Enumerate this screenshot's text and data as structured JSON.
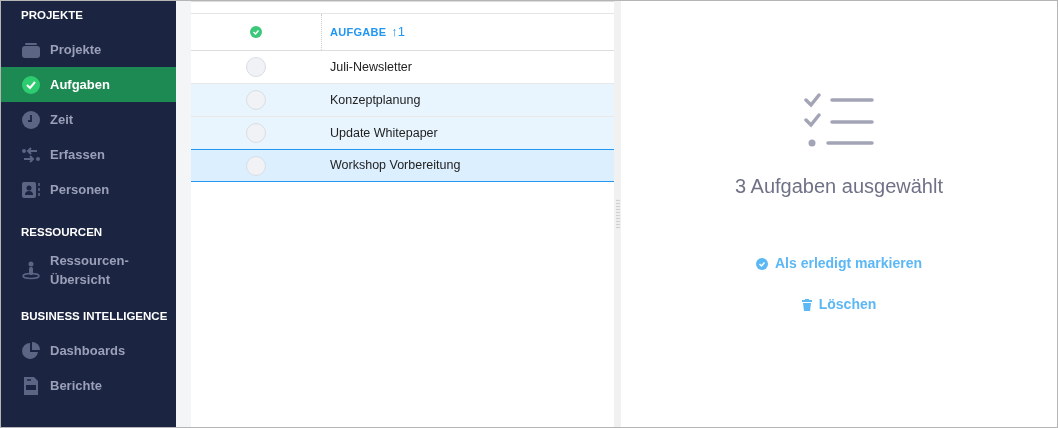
{
  "sidebar": {
    "sections": [
      {
        "title": "PROJEKTE",
        "items": [
          {
            "label": "Projekte",
            "kind": "stack",
            "selected": false
          },
          {
            "label": "Aufgaben",
            "kind": "check",
            "selected": true
          },
          {
            "label": "Zeit",
            "kind": "clock",
            "selected": false
          },
          {
            "label": "Erfassen",
            "kind": "swap",
            "selected": false
          },
          {
            "label": "Personen",
            "kind": "person",
            "selected": false
          }
        ]
      },
      {
        "title": "RESSOURCEN",
        "items": [
          {
            "label": "Ressourcen-Übersicht",
            "kind": "pin",
            "selected": false
          }
        ]
      },
      {
        "title": "BUSINESS INTELLIGENCE",
        "items": [
          {
            "label": "Dashboards",
            "kind": "pie",
            "selected": false
          },
          {
            "label": "Berichte",
            "kind": "doc",
            "selected": false
          }
        ]
      }
    ]
  },
  "table": {
    "column": "AUFGABE",
    "sort": "↑1",
    "rows": [
      {
        "task": "Juli-Newsletter",
        "selected": false,
        "focused": false
      },
      {
        "task": "Konzeptplanung",
        "selected": true,
        "focused": false
      },
      {
        "task": "Update Whitepaper",
        "selected": true,
        "focused": false
      },
      {
        "task": "Workshop Vorbereitung",
        "selected": true,
        "focused": true
      }
    ]
  },
  "detail": {
    "heading": "3 Aufgaben ausgewählt",
    "actions": [
      {
        "label": "Als erledigt markieren",
        "kind": "check"
      },
      {
        "label": "Löschen",
        "kind": "trash"
      }
    ]
  }
}
